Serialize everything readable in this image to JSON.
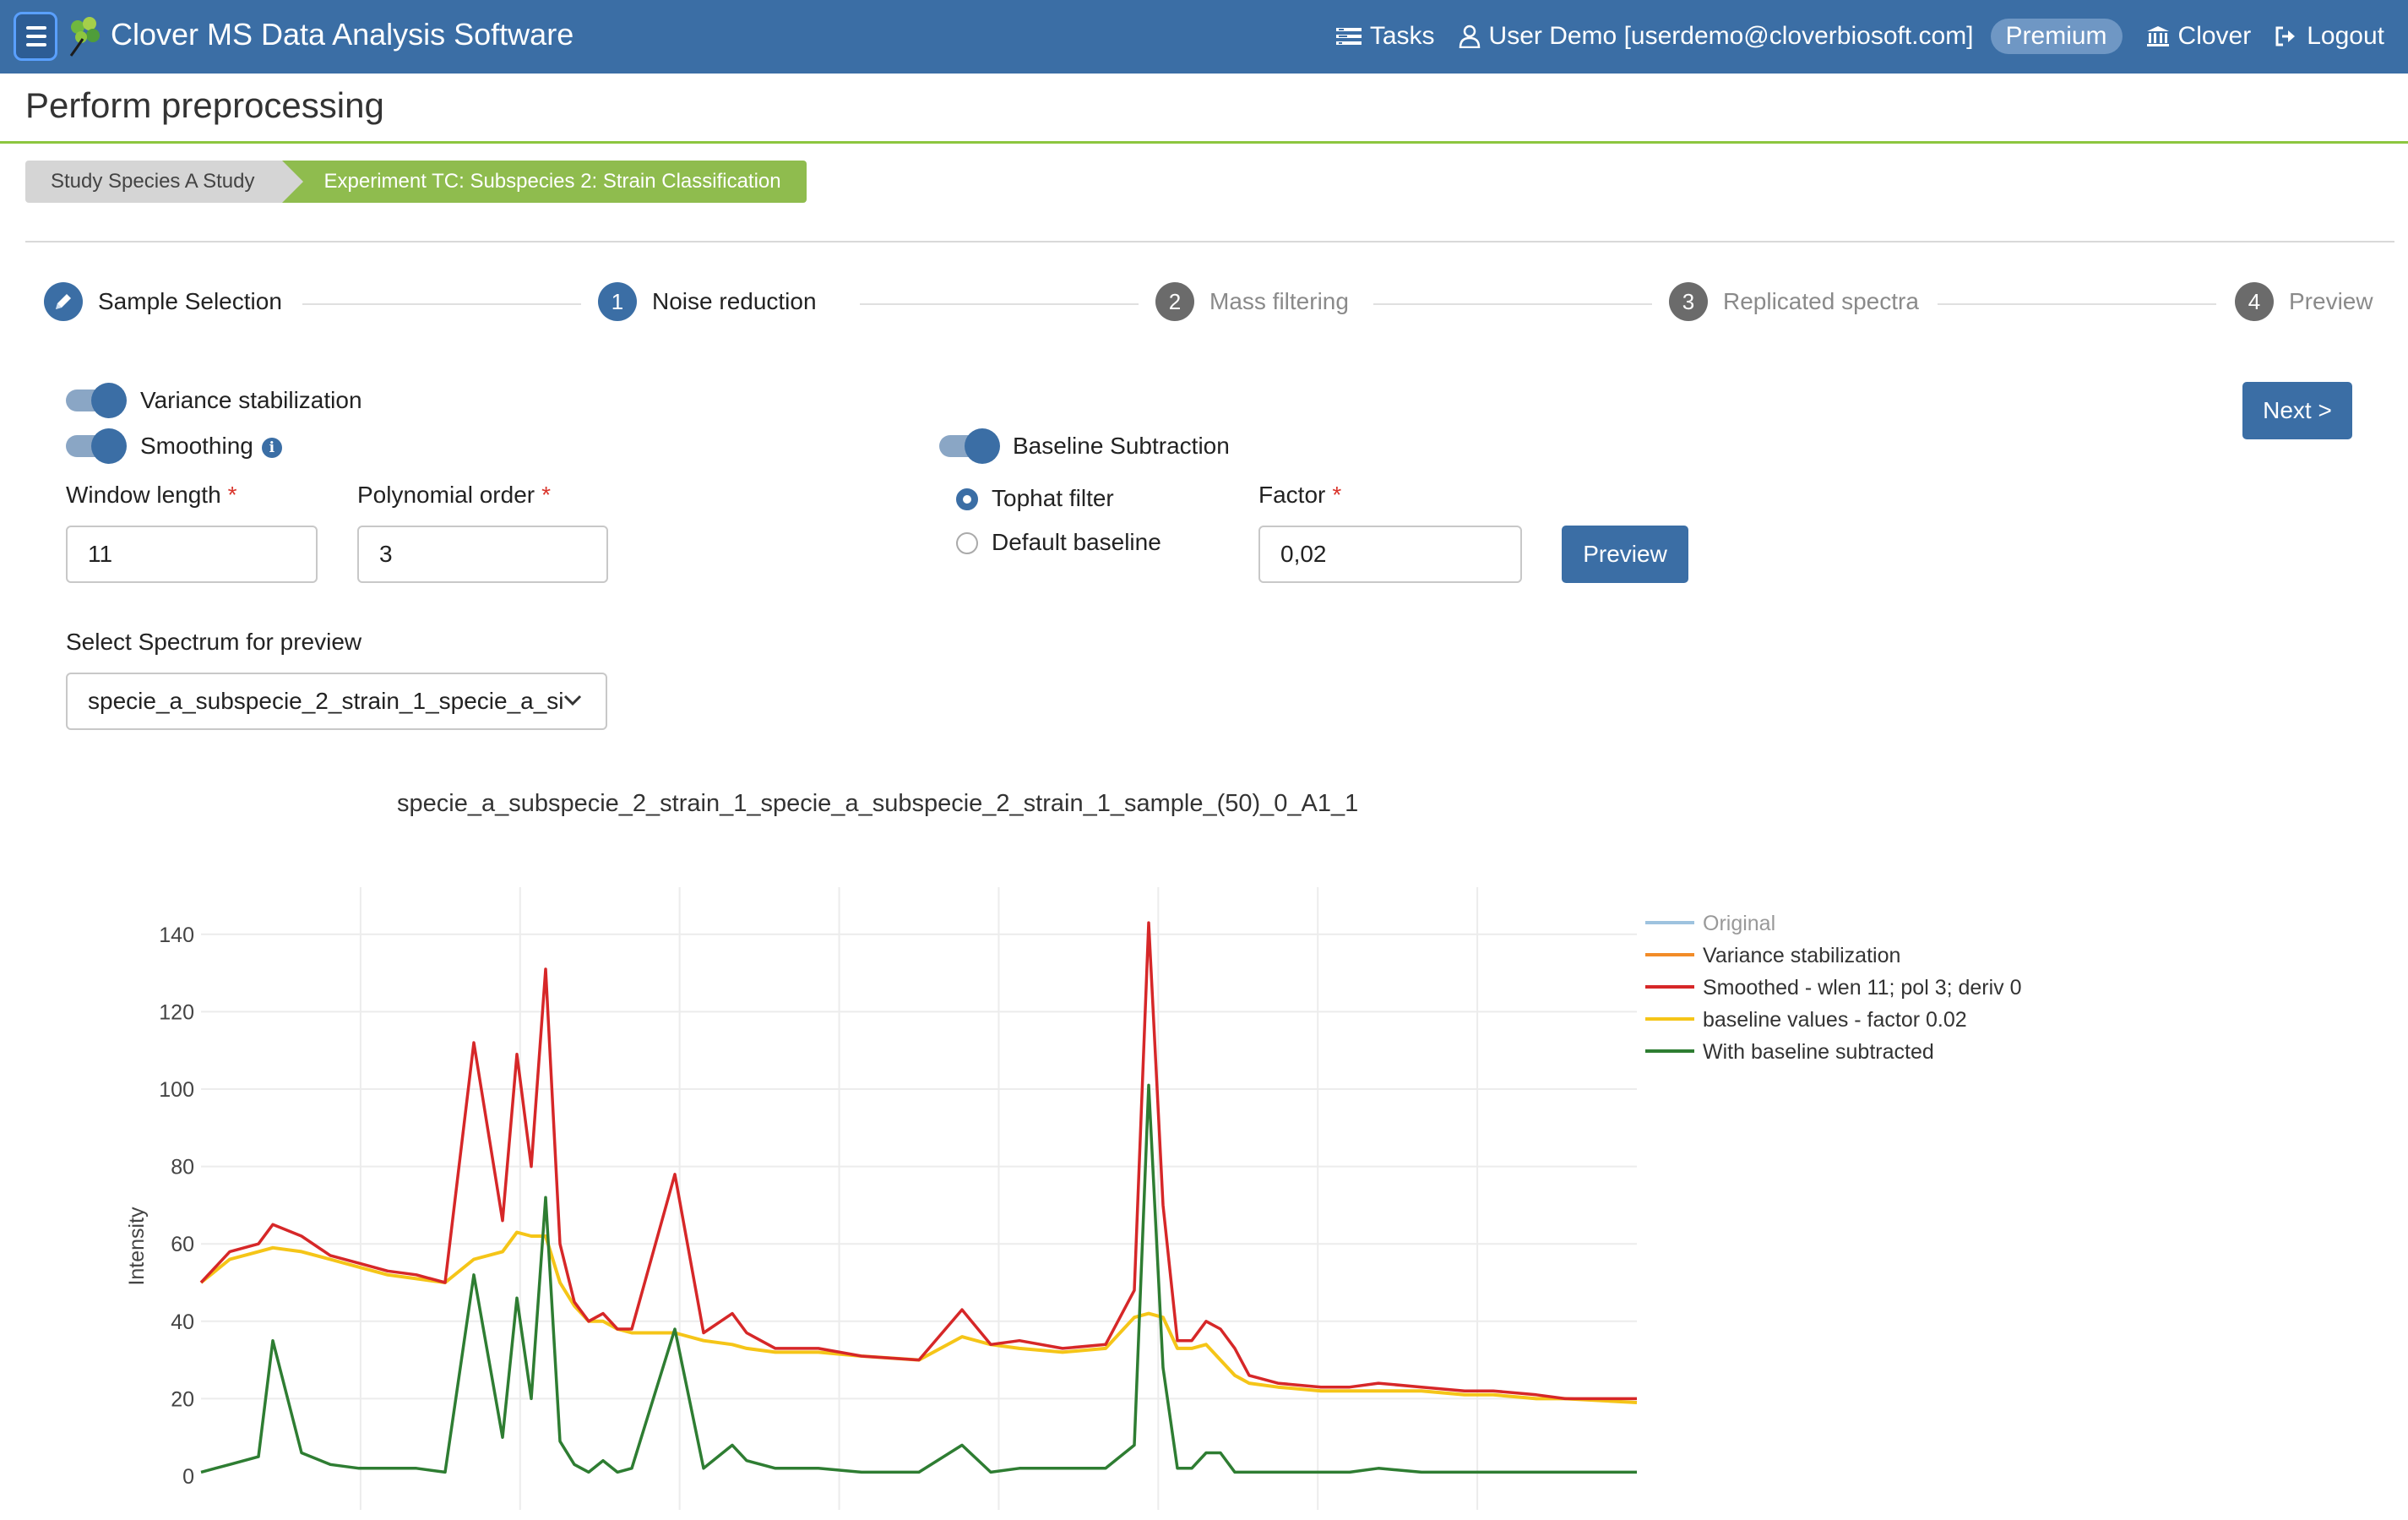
{
  "nav": {
    "app_title": "Clover MS Data Analysis Software",
    "tasks": "Tasks",
    "user": "User Demo [userdemo@cloverbiosoft.com]",
    "premium": "Premium",
    "clover": "Clover",
    "logout": "Logout"
  },
  "page": {
    "title": "Perform preprocessing"
  },
  "breadcrumb": {
    "study": "Study Species A Study",
    "experiment": "Experiment TC: Subspecies 2: Strain Classification"
  },
  "stepper": {
    "steps": [
      {
        "num": "",
        "label": "Sample Selection",
        "state": "done"
      },
      {
        "num": "1",
        "label": "Noise reduction",
        "state": "active"
      },
      {
        "num": "2",
        "label": "Mass filtering",
        "state": "inactive"
      },
      {
        "num": "3",
        "label": "Replicated spectra",
        "state": "inactive"
      },
      {
        "num": "4",
        "label": "Preview",
        "state": "inactive"
      }
    ]
  },
  "form": {
    "variance_label": "Variance stabilization",
    "variance_on": true,
    "smoothing_label": "Smoothing",
    "smoothing_on": true,
    "info_glyph": "i",
    "window_label": "Window length",
    "window_value": "11",
    "poly_label": "Polynomial order",
    "poly_value": "3",
    "baseline_label": "Baseline Subtraction",
    "baseline_on": true,
    "tophat_label": "Tophat filter",
    "default_label": "Default baseline",
    "factor_label": "Factor",
    "factor_value": "0,02",
    "required_mark": "*",
    "preview_button": "Preview",
    "next_button": "Next >",
    "select_label": "Select Spectrum for preview",
    "select_value": "specie_a_subspecie_2_strain_1_specie_a_si"
  },
  "colors": {
    "primary": "#3b6ea5",
    "accent_green": "#8dc63f",
    "original": "#9ec3df",
    "variance": "#f28c28",
    "smoothed": "#d62728",
    "baseline": "#f5c518",
    "subtracted": "#2e7d32"
  },
  "chart_data": {
    "type": "line",
    "title": "specie_a_subspecie_2_strain_1_specie_a_subspecie_2_strain_1_sample_(50)_0_A1_1",
    "xlabel": "",
    "ylabel": "Intensity",
    "ylim": [
      0,
      150
    ],
    "yticks": [
      0,
      20,
      40,
      60,
      80,
      100,
      120,
      140
    ],
    "grid": true,
    "legend_position": "top-right",
    "x": [
      0,
      2,
      4,
      5,
      7,
      9,
      11,
      13,
      15,
      17,
      19,
      21,
      22,
      23,
      24,
      25,
      26,
      27,
      28,
      29,
      30,
      33,
      35,
      37,
      38,
      40,
      43,
      46,
      50,
      53,
      55,
      57,
      60,
      63,
      65,
      66,
      67,
      68,
      69,
      70,
      71,
      72,
      73,
      75,
      78,
      80,
      82,
      85,
      88,
      90,
      93,
      95,
      100
    ],
    "series": [
      {
        "name": "Original",
        "values": []
      },
      {
        "name": "Variance stabilization",
        "values": []
      },
      {
        "name": "Smoothed - wlen 11; pol 3; deriv 0",
        "values": [
          50,
          58,
          60,
          65,
          62,
          57,
          55,
          53,
          52,
          50,
          112,
          66,
          109,
          80,
          131,
          60,
          45,
          40,
          42,
          38,
          38,
          78,
          37,
          42,
          37,
          33,
          33,
          31,
          30,
          43,
          34,
          35,
          33,
          34,
          48,
          143,
          70,
          35,
          35,
          40,
          38,
          33,
          26,
          24,
          23,
          23,
          24,
          23,
          22,
          22,
          21,
          20,
          20
        ]
      },
      {
        "name": "baseline values - factor 0.02",
        "values": [
          50,
          56,
          58,
          59,
          58,
          56,
          54,
          52,
          51,
          50,
          56,
          58,
          63,
          62,
          62,
          50,
          44,
          40,
          40,
          38,
          37,
          37,
          35,
          34,
          33,
          32,
          32,
          31,
          30,
          36,
          34,
          33,
          32,
          33,
          41,
          42,
          41,
          33,
          33,
          34,
          30,
          26,
          24,
          23,
          22,
          22,
          22,
          22,
          21,
          21,
          20,
          20,
          19
        ]
      },
      {
        "name": "With baseline subtracted",
        "values": [
          1,
          3,
          5,
          35,
          6,
          3,
          2,
          2,
          2,
          1,
          52,
          10,
          46,
          20,
          72,
          9,
          3,
          1,
          4,
          1,
          2,
          38,
          2,
          8,
          4,
          2,
          2,
          1,
          1,
          8,
          1,
          2,
          2,
          2,
          8,
          101,
          28,
          2,
          2,
          6,
          6,
          1,
          1,
          1,
          1,
          1,
          2,
          1,
          1,
          1,
          1,
          1,
          1
        ]
      }
    ]
  }
}
